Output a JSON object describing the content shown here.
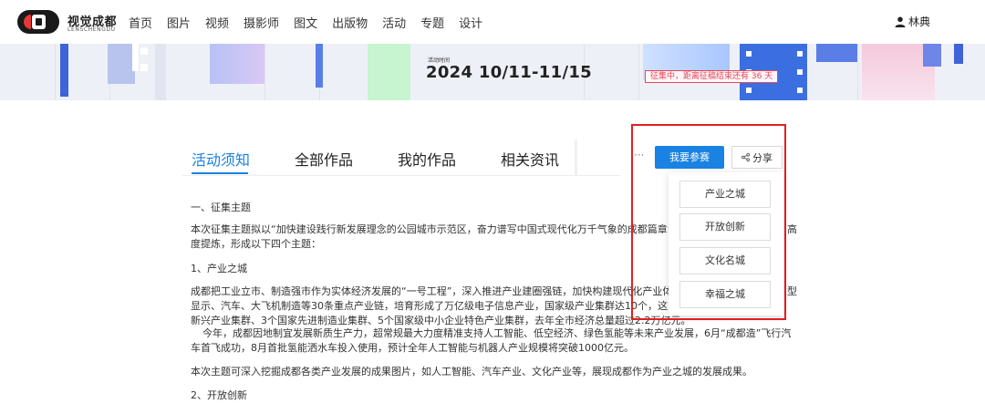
{
  "header": {
    "logo_cn": "视觉成都",
    "logo_en": "LENSCHENGDU",
    "nav": [
      "首页",
      "图片",
      "视频",
      "摄影师",
      "图文",
      "出版物",
      "活动",
      "专题",
      "设计"
    ],
    "user_name": "林典"
  },
  "banner": {
    "label": "活动时间",
    "date": "2024 10/11-11/15",
    "badge": "征集中，距离征稿结束还有 36 天"
  },
  "tabs": [
    "活动须知",
    "全部作品",
    "我的作品",
    "相关资讯"
  ],
  "actions": {
    "more": "···",
    "join": "我要参赛",
    "share": "分享"
  },
  "dropdown": [
    "产业之城",
    "开放创新",
    "文化名城",
    "幸福之城"
  ],
  "article": {
    "s1_title": "一、征集主题",
    "s1_line1": "本次征集主题拟以“加快建设践行新发展理念的公园城市示范区，奋力谱写中国式现代化万千气象的成都篇章”的",
    "s1_line1_tail": "高",
    "s1_line2": "度提炼，形成以下四个主题：",
    "sub1_title": "1、产业之城",
    "p1_line1": "成都把工业立市、制造强市作为实体经济发展的“一号工程”，深入推进产业建圈强链，加快构建现代化产业体系",
    "p1_line1_tail": "型",
    "p1_line2": "显示、汽车、大飞机制造等30条重点产业链，培育形成了万亿级电子信息产业，国家级产业集群达10个，这里",
    "p1_line3": "新兴产业集群、3个国家先进制造业集群、5个国家级中小企业特色产业集群，去年全市经济总量超过2.2万亿元。",
    "p2_line1": "今年，成都因地制宜发展新质生产力，超常规最大力度精准支持人工智能、低空经济、绿色氢能等未来产业发展，6月“成都造”飞行汽",
    "p2_line2": "车首飞成功，8月首批氢能洒水车投入使用，预计全年人工智能与机器人产业规模将突破1000亿元。",
    "p3": "本次主题可深入挖掘成都各类产业发展的成果图片，如人工智能、汽车产业、文化产业等，展现成都作为产业之城的发展成果。",
    "sub2_title": "2、开放创新"
  },
  "colors": {
    "accent": "#1a82e2",
    "badge": "#e6465a",
    "highlight": "#e02020"
  }
}
